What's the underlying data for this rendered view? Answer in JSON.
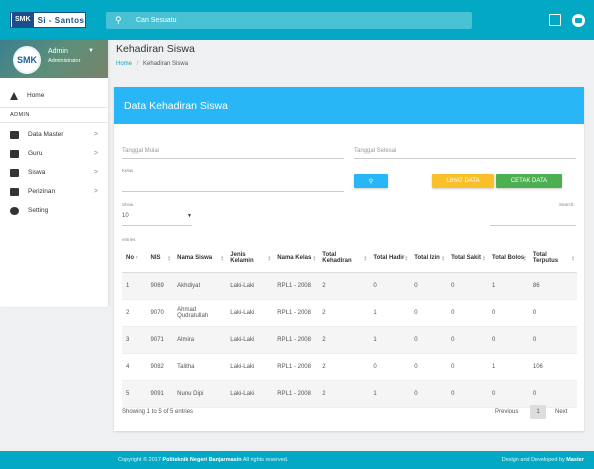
{
  "app": {
    "logo_badge": "SMK",
    "logo_text": "Si - Santos",
    "search_placeholder": "Cari Sesuatu"
  },
  "sidebar": {
    "user_name": "Admin",
    "user_role": "Administrator",
    "avatar_text": "SMK",
    "section_header": "ADMIN",
    "items": [
      {
        "label": "Home",
        "icon": "home-icon"
      },
      {
        "label": "Data Master",
        "icon": "folder-icon",
        "chevron": ">"
      },
      {
        "label": "Guru",
        "icon": "person-icon",
        "chevron": ">"
      },
      {
        "label": "Siswa",
        "icon": "person-icon",
        "chevron": ">"
      },
      {
        "label": "Perizinan",
        "icon": "person-icon",
        "chevron": ">"
      },
      {
        "label": "Setting",
        "icon": "gear-icon"
      }
    ]
  },
  "page": {
    "title": "Kehadiran Siswa",
    "breadcrumb_home": "Home",
    "breadcrumb_sep": "/",
    "breadcrumb_current": "Kehadiran Siswa"
  },
  "card": {
    "title": "Data Kehadiran Siswa",
    "tanggal_mulai_placeholder": "Tanggal Mulai",
    "tanggal_selesai_placeholder": "Tanggal Selesai",
    "kelas_label": "Kelas",
    "btn_lihat": "LIHAT DATA",
    "btn_cetak": "CETAK DATA",
    "show_label": "Show",
    "show_value": "10",
    "entries_label": "entries",
    "search_label": "Search:"
  },
  "table": {
    "headers": [
      "No",
      "NIS",
      "Nama Siswa",
      "Jenis Kelamin",
      "Nama Kelas",
      "Total Kehadiran",
      "Total Hadir",
      "Total Izin",
      "Total Sakit",
      "Total Bolos",
      "Total Terputus"
    ],
    "rows": [
      [
        "1",
        "9069",
        "Akhdiyat",
        "Laki-Laki",
        "RPL1 - 2008",
        "2",
        "0",
        "0",
        "0",
        "1",
        "86"
      ],
      [
        "2",
        "9070",
        "Ahmad Qudratullah",
        "Laki-Laki",
        "RPL1 - 2008",
        "2",
        "1",
        "0",
        "0",
        "0",
        "0"
      ],
      [
        "3",
        "9071",
        "Almira",
        "Laki-Laki",
        "RPL1 - 2008",
        "2",
        "1",
        "0",
        "0",
        "0",
        "0"
      ],
      [
        "4",
        "9082",
        "Talitha",
        "Laki-Laki",
        "RPL1 - 2008",
        "2",
        "0",
        "0",
        "0",
        "1",
        "106"
      ],
      [
        "5",
        "9091",
        "Nunu Dipi",
        "Laki-Laki",
        "RPL1 - 2008",
        "2",
        "1",
        "0",
        "0",
        "0",
        "0"
      ]
    ],
    "info": "Showing 1 to 5 of 5 entries",
    "prev": "Previous",
    "page": "1",
    "next": "Next"
  },
  "footer": {
    "copyright_prefix": "Copyright © 2017",
    "org": "Politeknik Negeri Banjarmasin",
    "rights": "All rights reserved.",
    "designed_prefix": "Design and Developed by",
    "designer": "Master"
  },
  "colors": {
    "topbar": "#03a9c4",
    "card_header": "#29b6f6",
    "btn_lihat": "#f9c02a",
    "btn_cetak": "#4caf50"
  }
}
